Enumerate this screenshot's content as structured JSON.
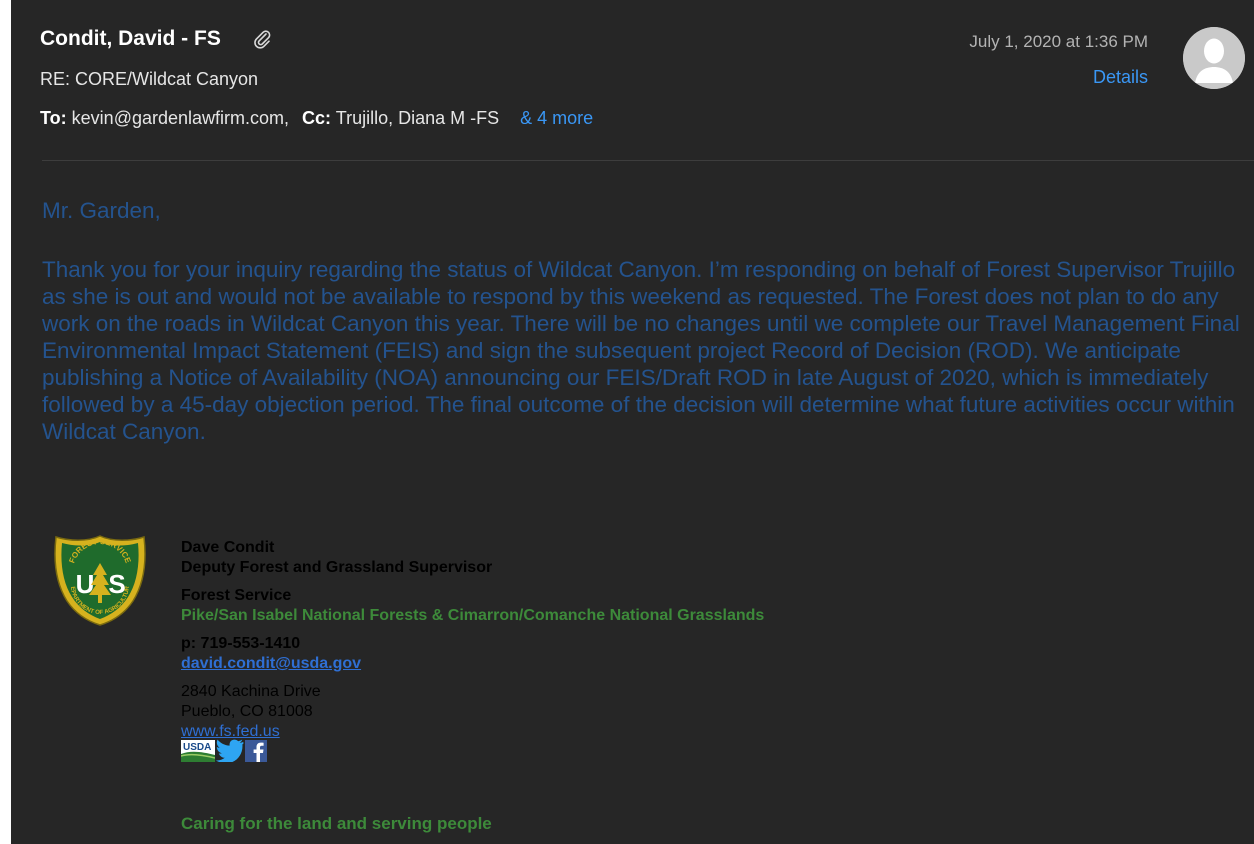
{
  "header": {
    "sender": "Condit, David - FS",
    "subject": "RE: CORE/Wildcat Canyon",
    "to_label": "To:",
    "to_value": "kevin@gardenlawfirm.com,",
    "cc_label": "Cc:",
    "cc_value": "Trujillo, Diana M -FS",
    "more_label": "& 4 more",
    "date": "July 1, 2020 at 1:36 PM",
    "details_label": "Details",
    "icons": {
      "attachment": "paperclip-icon",
      "avatar": "person-avatar-icon"
    }
  },
  "body": {
    "greeting": "Mr. Garden,",
    "paragraph": "Thank you for your inquiry regarding the status of Wildcat Canyon. I’m responding on behalf of Forest Supervisor Trujillo as she is out and would not be available to respond by this weekend as requested. The Forest does not plan to do any work on the roads in Wildcat Canyon this year. There will be no changes until we complete our Travel Management Final Environmental Impact Statement (FEIS) and sign the subsequent project Record of Decision (ROD). We anticipate publishing a Notice of Availability (NOA) announcing our FEIS/Draft ROD in late August of 2020, which is immediately followed by a 45-day objection period. The final outcome of the decision will determine what future activities occur within Wildcat Canyon."
  },
  "signature": {
    "name": "Dave Condit",
    "title": "Deputy Forest and Grassland Supervisor",
    "agency": "Forest Service",
    "unit": "Pike/San Isabel National Forests & Cimarron/Comanche National Grasslands",
    "phone": "p: 719-553-1410",
    "email": "david.condit@usda.gov",
    "address_line1": "2840 Kachina Drive",
    "address_line2": "Pueblo, CO 81008",
    "website": "www.fs.fed.us",
    "tagline": "Caring for the land and serving people",
    "logo_text_top": "FOREST SERVICE",
    "logo_text_bottom": "DEPARTMENT OF AGRICULTURE",
    "logo_letters": "US",
    "usda_text": "USDA",
    "icons": {
      "logo": "forest-service-shield-icon",
      "usda": "usda-logo-icon",
      "twitter": "twitter-icon",
      "facebook": "facebook-icon"
    }
  },
  "colors": {
    "background": "#262626",
    "link_blue": "#3a97f5",
    "body_text": "#24538e",
    "signature_green": "#3d8a3a"
  }
}
